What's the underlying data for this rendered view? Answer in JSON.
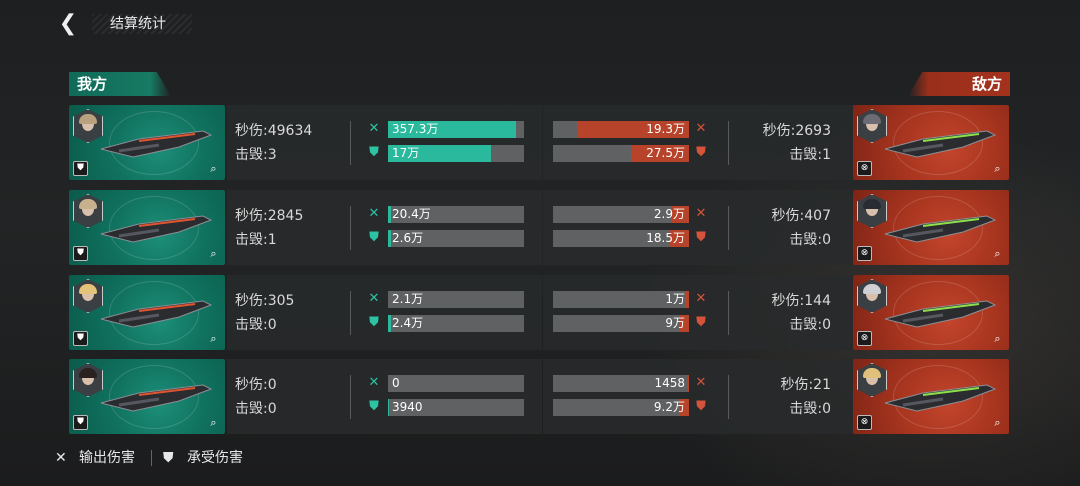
{
  "header": {
    "title": "结算统计"
  },
  "teams": {
    "ally_label": "我方",
    "enemy_label": "敌方"
  },
  "rows": [
    {
      "ally": {
        "dps": "秒伤:49634",
        "kills": "击毁:3",
        "dmg_out": "357.3万",
        "dmg_out_ratio": 0.94,
        "dmg_in": "17万",
        "dmg_in_ratio": 0.76
      },
      "enemy": {
        "dps": "秒伤:2693",
        "kills": "击毁:1",
        "dmg_out": "19.3万",
        "dmg_out_ratio": 0.82,
        "dmg_in": "27.5万",
        "dmg_in_ratio": 0.43
      }
    },
    {
      "ally": {
        "dps": "秒伤:2845",
        "kills": "击毁:1",
        "dmg_out": "20.4万",
        "dmg_out_ratio": 0.02,
        "dmg_in": "2.6万",
        "dmg_in_ratio": 0.02
      },
      "enemy": {
        "dps": "秒伤:407",
        "kills": "击毁:0",
        "dmg_out": "2.9万",
        "dmg_out_ratio": 0.13,
        "dmg_in": "18.5万",
        "dmg_in_ratio": 0.14
      }
    },
    {
      "ally": {
        "dps": "秒伤:305",
        "kills": "击毁:0",
        "dmg_out": "2.1万",
        "dmg_out_ratio": 0.0,
        "dmg_in": "2.4万",
        "dmg_in_ratio": 0.02
      },
      "enemy": {
        "dps": "秒伤:144",
        "kills": "击毁:0",
        "dmg_out": "1万",
        "dmg_out_ratio": 0.03,
        "dmg_in": "9万",
        "dmg_in_ratio": 0.07
      }
    },
    {
      "ally": {
        "dps": "秒伤:0",
        "kills": "击毁:0",
        "dmg_out": "0",
        "dmg_out_ratio": 0.0,
        "dmg_in": "3940",
        "dmg_in_ratio": 0.01
      },
      "enemy": {
        "dps": "秒伤:21",
        "kills": "击毁:0",
        "dmg_out": "1458",
        "dmg_out_ratio": 0.01,
        "dmg_in": "9.2万",
        "dmg_in_ratio": 0.07
      }
    }
  ],
  "legend": {
    "output_damage": "输出伤害",
    "taken_damage": "承受伤害"
  },
  "icons": {
    "back": "back-arrow-icon",
    "output": "crossed-swords-icon",
    "taken": "shield-icon",
    "detail": "detail-search-icon",
    "class": "ship-class-icon"
  },
  "colors": {
    "ally": "#10725f",
    "ally_bar": "#2ab99c",
    "enemy": "#a8351f",
    "enemy_bar": "#b7432b",
    "bar_track": "#5f6163"
  }
}
